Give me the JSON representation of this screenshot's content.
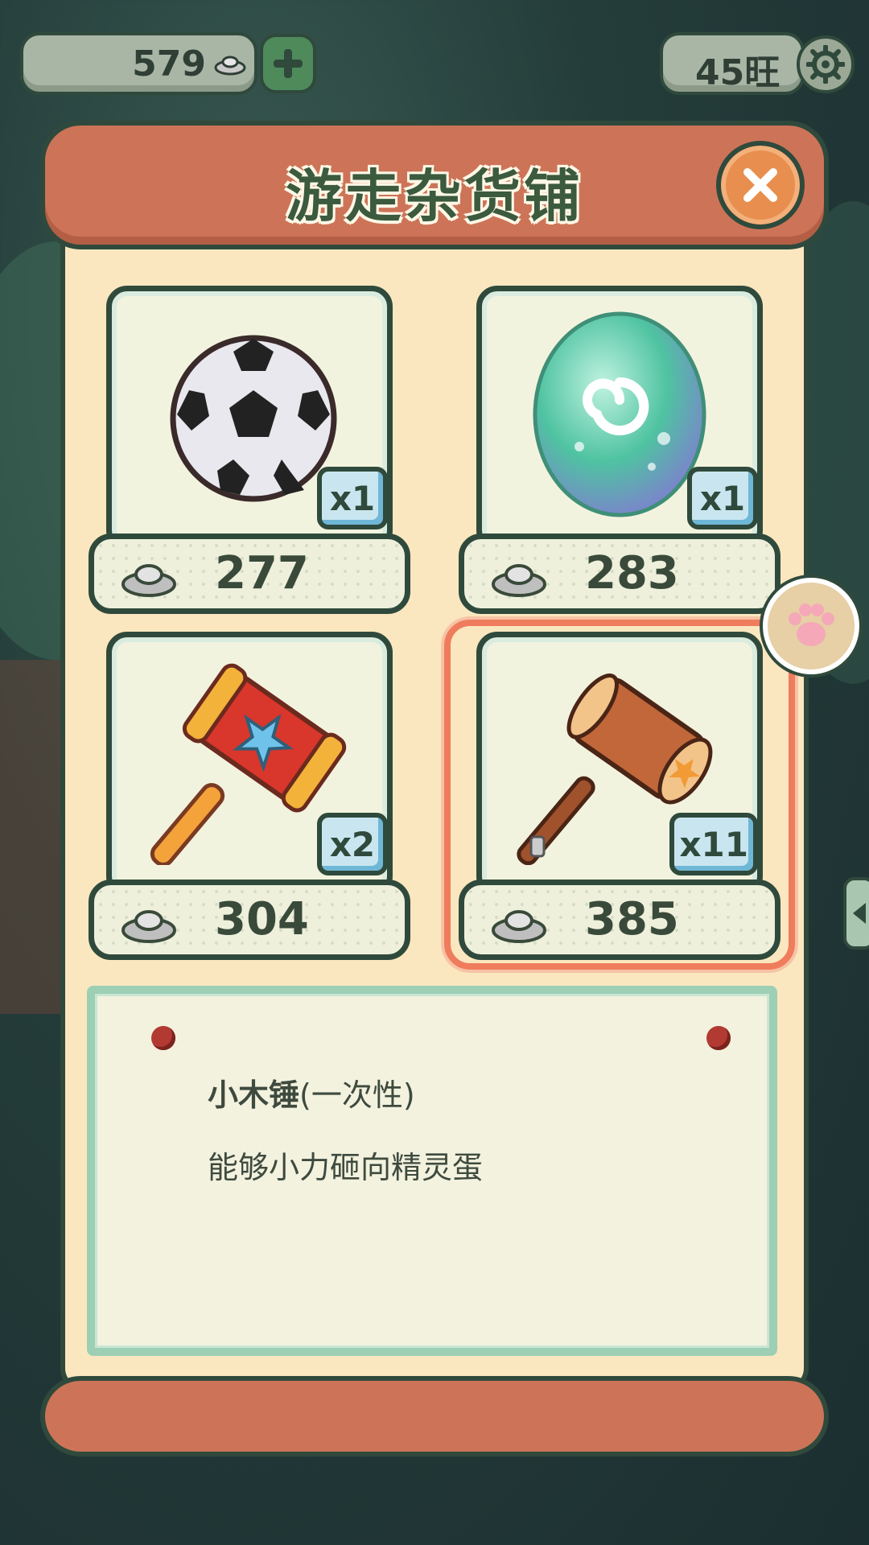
{
  "top_bar": {
    "currency_value": "579",
    "level_value": "45旺"
  },
  "shop": {
    "title": "游走杂货铺",
    "items": [
      {
        "name": "soccer-ball",
        "quantity": "x1",
        "price": "277"
      },
      {
        "name": "spirit-egg",
        "quantity": "x1",
        "price": "283"
      },
      {
        "name": "star-hammer",
        "quantity": "x2",
        "price": "304"
      },
      {
        "name": "wooden-mallet",
        "quantity": "x11",
        "price": "385",
        "selected": true
      }
    ]
  },
  "description": {
    "item_name": "小木锤",
    "item_suffix": "(一次性)",
    "item_text": "能够小力砸向精灵蛋"
  },
  "colors": {
    "panel": "#fbe7bf",
    "header": "#cd7458",
    "outline": "#2f4a3c",
    "selection": "#ef7c5c",
    "badge": "#c9e6f0"
  }
}
